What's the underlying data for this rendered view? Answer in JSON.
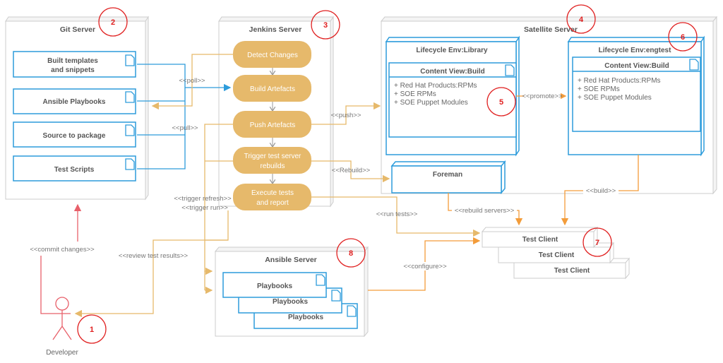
{
  "colors": {
    "server_border": "#cccccc",
    "artifact_blue": "#2d9cdb",
    "step_fill": "#e6b96b",
    "connector_tan": "#e6b96b",
    "connector_orange": "#f39c3a",
    "commit_red": "#e8606a",
    "badge_red": "#e02020"
  },
  "git_server": {
    "title": "Git Server",
    "badge": "2",
    "artifacts": [
      "Built templates",
      "and snippets",
      "Ansible Playbooks",
      "Source to package",
      "Test Scripts"
    ]
  },
  "jenkins_server": {
    "title": "Jenkins Server",
    "badge": "3",
    "steps": [
      "Detect Changes",
      "Build Artefacts",
      "Push Artefacts",
      "Trigger test server",
      "rebuilds",
      "Execute tests",
      "and report"
    ]
  },
  "satellite_server": {
    "title": "Satellite Server",
    "badge": "4",
    "library": {
      "title": "Lifecycle Env:Library",
      "content_view": "Content View:Build",
      "badge": "5",
      "items": [
        "+ Red Hat Products:RPMs",
        "+ SOE RPMs",
        "+ SOE Puppet Modules"
      ]
    },
    "engtest": {
      "title": "Lifecycle Env:engtest",
      "content_view": "Content View:Build",
      "badge": "6",
      "items": [
        "+ Red Hat Products:RPMs",
        "+ SOE RPMs",
        "+ SOE Puppet Modules"
      ]
    },
    "foreman": "Foreman"
  },
  "test_clients": {
    "labels": [
      "Test Client",
      "Test Client",
      "Test Client"
    ],
    "badge": "7"
  },
  "ansible_server": {
    "title": "Ansible Server",
    "badge": "8",
    "playbooks": [
      "Playbooks",
      "Playbooks",
      "Playbooks"
    ]
  },
  "developer": {
    "label": "Developer",
    "badge": "1"
  },
  "connectors": {
    "poll": "<<poll>>",
    "pull": "<<pull>>",
    "push": "<<push>>",
    "rebuild": "<<Rebuild>>",
    "promote": "<<promote>>",
    "build": "<<build>>",
    "rebuild_servers": "<<rebuild servers>>",
    "run_tests": "<<run tests>>",
    "configure": "<<configure>>",
    "trigger_refresh": "<<trigger refresh>>",
    "trigger_run": "<<trigger run>>",
    "commit_changes": "<<commit changes>>",
    "review_test_results": "<<review test results>>"
  }
}
